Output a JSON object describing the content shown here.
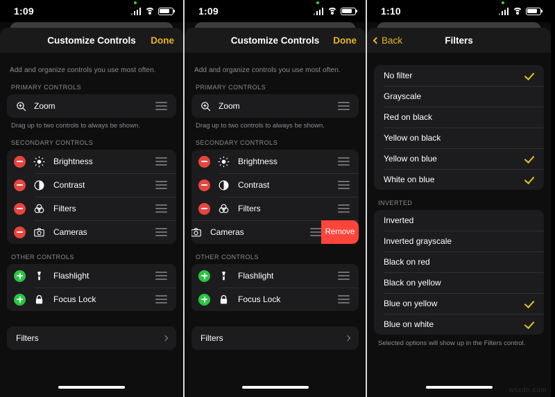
{
  "panels": [
    {
      "status": {
        "time": "1:09",
        "battery_icon": "battery-icon",
        "wifi_icon": "wifi-icon",
        "signal_icon": "cellular-icon",
        "recording_dot": "green-indicator-dot"
      },
      "nav": {
        "title": "Customize Controls",
        "right_label": "Done"
      },
      "intro": "Add and organize controls you use most often.",
      "sections": [
        {
          "header": "PRIMARY CONTROLS",
          "rows": [
            {
              "label": "Zoom",
              "icon": "zoom-in-icon",
              "badge": "none",
              "handle": true
            }
          ],
          "hint": "Drag up to two controls to always be shown."
        },
        {
          "header": "SECONDARY CONTROLS",
          "rows": [
            {
              "label": "Brightness",
              "icon": "brightness-icon",
              "badge": "minus",
              "handle": true
            },
            {
              "label": "Contrast",
              "icon": "contrast-icon",
              "badge": "minus",
              "handle": true
            },
            {
              "label": "Filters",
              "icon": "filters-icon",
              "badge": "minus",
              "handle": true
            },
            {
              "label": "Cameras",
              "icon": "camera-icon",
              "badge": "minus",
              "handle": true
            }
          ]
        },
        {
          "header": "OTHER CONTROLS",
          "rows": [
            {
              "label": "Flashlight",
              "icon": "flashlight-icon",
              "badge": "plus",
              "handle": true
            },
            {
              "label": "Focus Lock",
              "icon": "lock-icon",
              "badge": "plus",
              "handle": true
            }
          ]
        }
      ],
      "disclosure": {
        "label": "Filters",
        "chevron": "chevron-right-icon"
      }
    },
    {
      "status": {
        "time": "1:09"
      },
      "nav": {
        "title": "Customize Controls",
        "right_label": "Done"
      },
      "intro": "Add and organize controls you use most often.",
      "swiped_row": {
        "label": "Cameras",
        "remove_label": "Remove"
      },
      "disclosure": {
        "label": "Filters"
      }
    },
    {
      "status": {
        "time": "1:10"
      },
      "nav": {
        "back_label": "Back",
        "title": "Filters"
      },
      "sections": [
        {
          "header": "",
          "rows": [
            {
              "label": "No filter",
              "checked": true
            },
            {
              "label": "Grayscale",
              "checked": false
            },
            {
              "label": "Red on black",
              "checked": false
            },
            {
              "label": "Yellow on black",
              "checked": false
            },
            {
              "label": "Yellow on blue",
              "checked": true
            },
            {
              "label": "White on blue",
              "checked": true
            }
          ]
        },
        {
          "header": "INVERTED",
          "rows": [
            {
              "label": "Inverted",
              "checked": false
            },
            {
              "label": "Inverted grayscale",
              "checked": false
            },
            {
              "label": "Black on red",
              "checked": false
            },
            {
              "label": "Black on yellow",
              "checked": false
            },
            {
              "label": "Blue on yellow",
              "checked": true
            },
            {
              "label": "Blue on white",
              "checked": true
            }
          ]
        }
      ],
      "footnote": "Selected options will show up in the Filters control."
    }
  ],
  "watermark": "wsxdn.com",
  "colors": {
    "accent_yellow": "#e6b422",
    "check_yellow": "#e8c51d",
    "remove_red": "#ff453a",
    "minus_red": "#e8453c",
    "plus_green": "#27c840",
    "sheet_bg": "#0e0e0f",
    "group_bg": "#1c1c1e"
  }
}
